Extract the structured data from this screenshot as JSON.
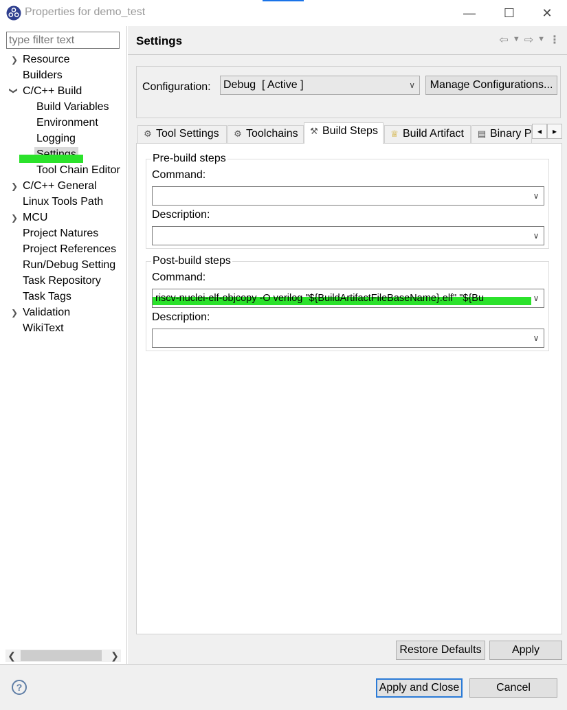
{
  "window": {
    "title": "Properties for demo_test",
    "min_glyph": "—",
    "max_glyph": "☐",
    "close_glyph": "✕"
  },
  "filter": {
    "placeholder": "type filter text"
  },
  "tree": {
    "items": [
      {
        "label": "Resource",
        "expandable": true
      },
      {
        "label": "Builders"
      },
      {
        "label": "C/C++ Build",
        "expanded": true
      },
      {
        "label": "Build Variables"
      },
      {
        "label": "Environment"
      },
      {
        "label": "Logging"
      },
      {
        "label": "Settings",
        "selected": true
      },
      {
        "label": "Tool Chain Editor"
      },
      {
        "label": "C/C++ General",
        "expandable": true
      },
      {
        "label": "Linux Tools Path"
      },
      {
        "label": "MCU",
        "expandable": true
      },
      {
        "label": "Project Natures"
      },
      {
        "label": "Project References"
      },
      {
        "label": "Run/Debug Setting"
      },
      {
        "label": "Task Repository"
      },
      {
        "label": "Task Tags"
      },
      {
        "label": "Validation",
        "expandable": true
      },
      {
        "label": "WikiText"
      }
    ]
  },
  "settings": {
    "title": "Settings",
    "configuration_label": "Configuration:",
    "configuration_value": "Debug  [ Active ]",
    "manage_label": "Manage Configurations..."
  },
  "tabs": [
    {
      "label": "Tool Settings",
      "icon": "tool-settings-icon"
    },
    {
      "label": "Toolchains",
      "icon": "toolchains-icon"
    },
    {
      "label": "Build Steps",
      "icon": "build-steps-icon",
      "active": true
    },
    {
      "label": "Build Artifact",
      "icon": "trophy-icon"
    },
    {
      "label": "Binary P",
      "icon": "binary-parsers-icon"
    }
  ],
  "pre_build": {
    "title": "Pre-build steps",
    "command_label": "Command:",
    "command_value": "",
    "description_label": "Description:",
    "description_value": ""
  },
  "post_build": {
    "title": "Post-build steps",
    "command_label": "Command:",
    "command_value": "riscv-nuclei-elf-objcopy -O verilog \"${BuildArtifactFileBaseName}.elf\" \"${Bu",
    "description_label": "Description:",
    "description_value": ""
  },
  "buttons": {
    "restore_defaults": "Restore Defaults",
    "apply": "Apply",
    "apply_and_close": "Apply and Close",
    "cancel": "Cancel",
    "help": "?"
  },
  "colors": {
    "highlight": "#2be22b",
    "accent": "#2a7ad7"
  }
}
